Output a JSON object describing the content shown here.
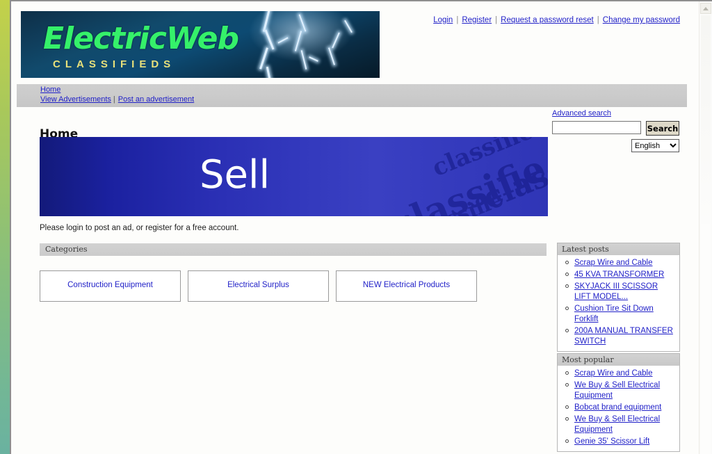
{
  "site": {
    "logo_word": "ElectricWeb",
    "logo_subtitle": "CLASSIFIEDS"
  },
  "account_links": [
    {
      "label": "Login"
    },
    {
      "label": "Register"
    },
    {
      "label": "Request a password reset"
    },
    {
      "label": "Change my password"
    }
  ],
  "nav": {
    "home": "Home",
    "view_ads": "View Advertisements",
    "post_ad": "Post an advertisement"
  },
  "page": {
    "title": "Home",
    "login_notice": "Please login to post an ad, or register for a free account."
  },
  "search": {
    "advanced_link": "Advanced search",
    "input_value": "",
    "input_placeholder": "",
    "button_label": "Search",
    "language_selected": "English",
    "language_options": [
      "English"
    ]
  },
  "banner": {
    "headline": "Sell",
    "watermark_text": "classifie"
  },
  "categories": {
    "header": "Categories",
    "items": [
      {
        "label": "Construction Equipment"
      },
      {
        "label": "Electrical Surplus"
      },
      {
        "label": "NEW Electrical Products"
      }
    ]
  },
  "sidebar": {
    "latest": {
      "title": "Latest posts",
      "items": [
        {
          "label": "Scrap Wire and Cable"
        },
        {
          "label": "45 KVA TRANSFORMER"
        },
        {
          "label": "SKYJACK III SCISSOR LIFT MODEL..."
        },
        {
          "label": "Cushion Tire Sit Down Forklift"
        },
        {
          "label": "200A MANUAL TRANSFER SWITCH"
        }
      ]
    },
    "popular": {
      "title": "Most popular",
      "items": [
        {
          "label": "Scrap Wire and Cable"
        },
        {
          "label": "We Buy & Sell Electrical Equipment"
        },
        {
          "label": "Bobcat brand equipment"
        },
        {
          "label": "We Buy & Sell Electrical Equipment"
        },
        {
          "label": "Genie 35' Scissor Lift"
        }
      ]
    }
  },
  "colors": {
    "link": "#2121c8",
    "logo_green": "#35f16a",
    "logo_yellow": "#e8e07a",
    "banner_blue": "#3339bd",
    "nav_gray": "#cbcbcb",
    "desktop_green_top": "#c3d14a",
    "desktop_green_bottom": "#6ab2a0"
  }
}
